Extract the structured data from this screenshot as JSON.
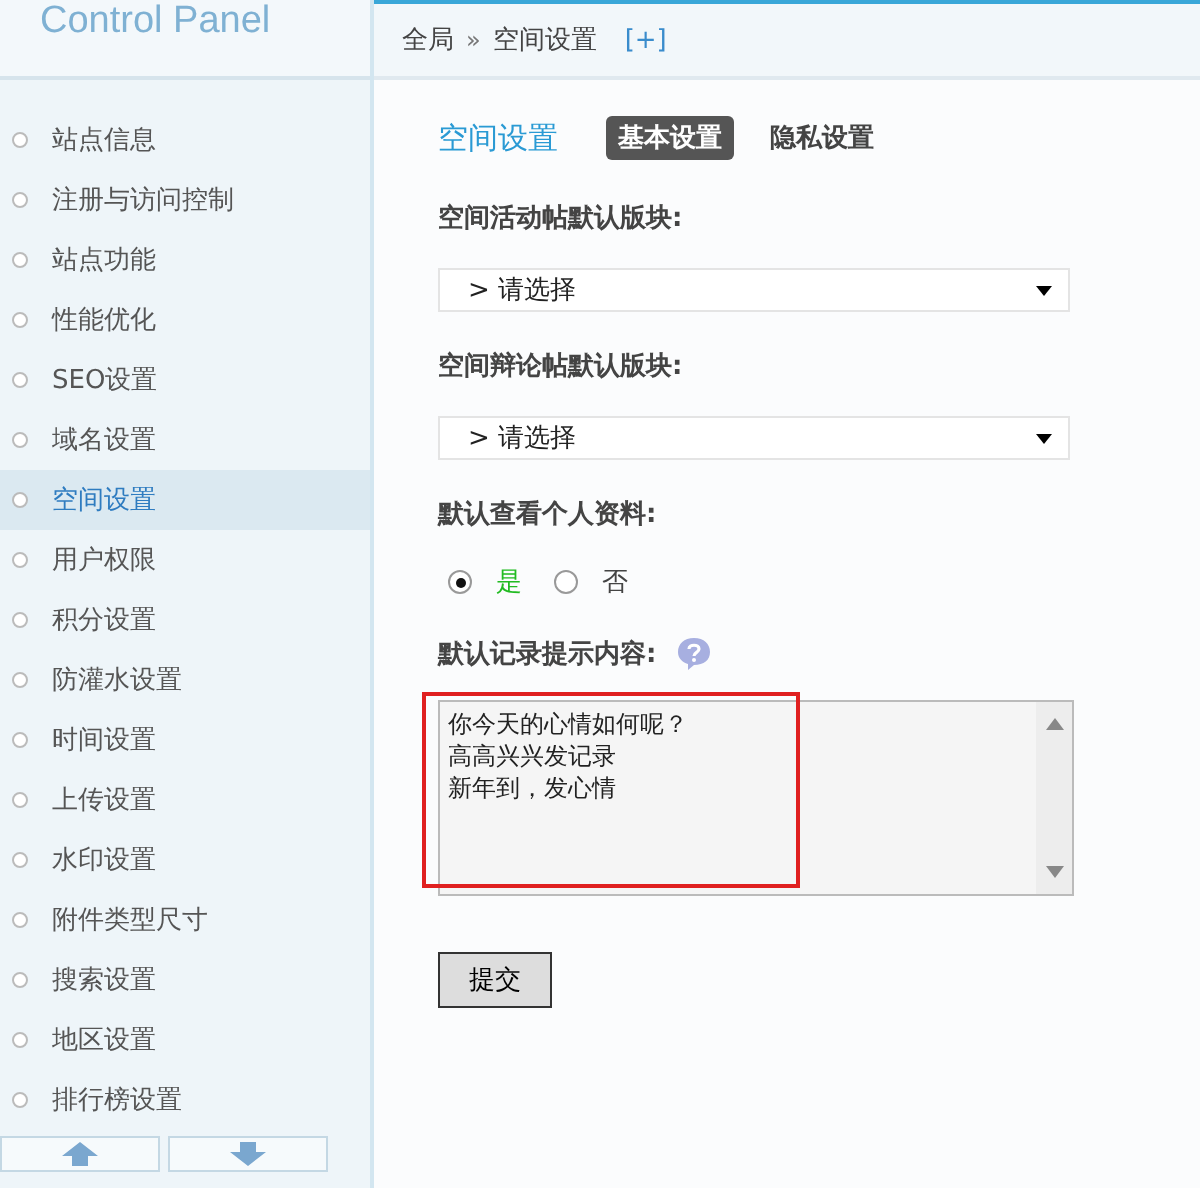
{
  "sidebar": {
    "brand": "Control Panel",
    "items": [
      {
        "label": "站点信息",
        "selected": false
      },
      {
        "label": "注册与访问控制",
        "selected": false
      },
      {
        "label": "站点功能",
        "selected": false
      },
      {
        "label": "性能优化",
        "selected": false
      },
      {
        "label": "SEO设置",
        "selected": false
      },
      {
        "label": "域名设置",
        "selected": false
      },
      {
        "label": "空间设置",
        "selected": true
      },
      {
        "label": "用户权限",
        "selected": false
      },
      {
        "label": "积分设置",
        "selected": false
      },
      {
        "label": "防灌水设置",
        "selected": false
      },
      {
        "label": "时间设置",
        "selected": false
      },
      {
        "label": "上传设置",
        "selected": false
      },
      {
        "label": "水印设置",
        "selected": false
      },
      {
        "label": "附件类型尺寸",
        "selected": false
      },
      {
        "label": "搜索设置",
        "selected": false
      },
      {
        "label": "地区设置",
        "selected": false
      },
      {
        "label": "排行榜设置",
        "selected": false
      }
    ]
  },
  "breadcrumb": {
    "root": "全局",
    "separator": "»",
    "current": "空间设置",
    "add": "[+]"
  },
  "page_title": "空间设置",
  "tabs": [
    {
      "label": "基本设置",
      "selected": true
    },
    {
      "label": "隐私设置",
      "selected": false
    }
  ],
  "fields": [
    {
      "kind": "select",
      "label": "空间活动帖默认版块:",
      "value": "> 请选择"
    },
    {
      "kind": "select",
      "label": "空间辩论帖默认版块:",
      "value": "> 请选择"
    },
    {
      "kind": "radio",
      "label": "默认查看个人资料:",
      "options": [
        {
          "label": "是",
          "selected": true
        },
        {
          "label": "否",
          "selected": false
        }
      ]
    },
    {
      "kind": "textarea",
      "label": "默认记录提示内容:",
      "help": true,
      "highlighted": true,
      "lines": [
        "你今天的心情如何呢？",
        "高高兴兴发记录",
        "新年到，发心情"
      ]
    }
  ],
  "submit": "提交"
}
